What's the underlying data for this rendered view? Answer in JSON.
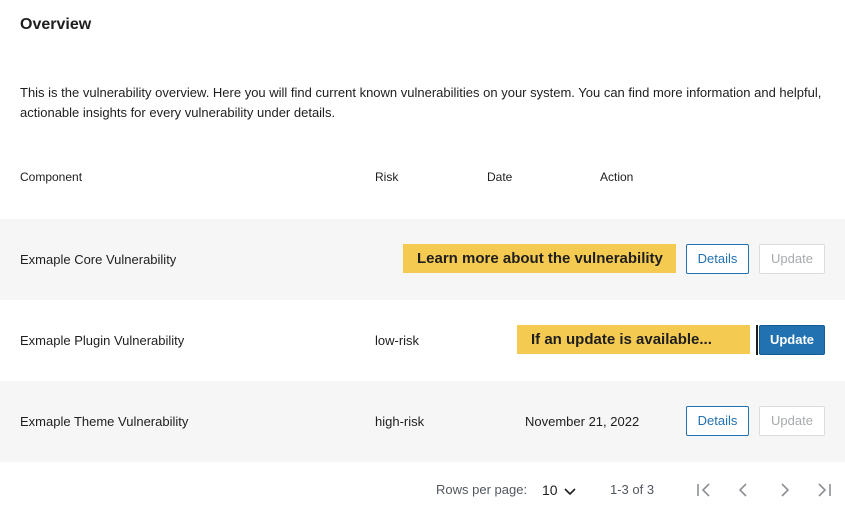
{
  "header": {
    "title": "Overview"
  },
  "description": "This is the vulnerability overview. Here you will find current known vulnerabilities on your system. You can find more information and helpful, actionable insights for every vulnerability under details.",
  "table": {
    "columns": [
      "Component",
      "Risk",
      "Date",
      "Action"
    ],
    "rows": [
      {
        "component": "Exmaple Core Vulnerability",
        "risk": "",
        "date": "",
        "details_label": "Details",
        "update_label": "Update",
        "update_enabled": false
      },
      {
        "component": "Exmaple Plugin Vulnerability",
        "risk": "low-risk",
        "date": "",
        "update_label": "Update",
        "update_enabled": true
      },
      {
        "component": "Exmaple Theme Vulnerability",
        "risk": "high-risk",
        "date": "November 21, 2022",
        "details_label": "Details",
        "update_label": "Update",
        "update_enabled": false
      }
    ]
  },
  "callouts": {
    "details": "Learn more about the vulnerability",
    "update": "If an update is available..."
  },
  "pagination": {
    "rows_per_page_label": "Rows per page:",
    "rows_per_page_value": "10",
    "range": "1-3 of 3",
    "icons": [
      "first-page-icon",
      "previous-page-icon",
      "next-page-icon",
      "last-page-icon"
    ]
  },
  "colors": {
    "accent": "#2271b1",
    "callout": "#f5ca51",
    "row_shade": "#f6f6f6"
  }
}
